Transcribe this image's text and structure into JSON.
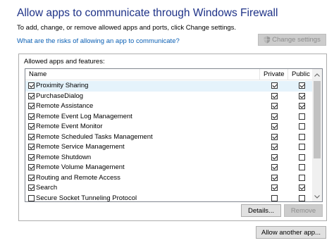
{
  "header": {
    "title": "Allow apps to communicate through Windows Firewall",
    "description": "To add, change, or remove allowed apps and ports, click Change settings.",
    "risk_link": "What are the risks of allowing an app to communicate?",
    "change_settings_label": "Change settings"
  },
  "group": {
    "label": "Allowed apps and features:"
  },
  "list": {
    "columns": {
      "name": "Name",
      "private": "Private",
      "public": "Public"
    },
    "rows": [
      {
        "name": "Proximity Sharing",
        "enabled": true,
        "private": true,
        "public": true,
        "selected": true
      },
      {
        "name": "PurchaseDialog",
        "enabled": true,
        "private": true,
        "public": true,
        "selected": false
      },
      {
        "name": "Remote Assistance",
        "enabled": true,
        "private": true,
        "public": true,
        "selected": false
      },
      {
        "name": "Remote Event Log Management",
        "enabled": true,
        "private": true,
        "public": false,
        "selected": false
      },
      {
        "name": "Remote Event Monitor",
        "enabled": true,
        "private": true,
        "public": false,
        "selected": false
      },
      {
        "name": "Remote Scheduled Tasks Management",
        "enabled": true,
        "private": true,
        "public": false,
        "selected": false
      },
      {
        "name": "Remote Service Management",
        "enabled": true,
        "private": true,
        "public": false,
        "selected": false
      },
      {
        "name": "Remote Shutdown",
        "enabled": true,
        "private": true,
        "public": false,
        "selected": false
      },
      {
        "name": "Remote Volume Management",
        "enabled": true,
        "private": true,
        "public": false,
        "selected": false
      },
      {
        "name": "Routing and Remote Access",
        "enabled": true,
        "private": true,
        "public": false,
        "selected": false
      },
      {
        "name": "Search",
        "enabled": true,
        "private": true,
        "public": true,
        "selected": false
      },
      {
        "name": "Secure Socket Tunneling Protocol",
        "enabled": false,
        "private": false,
        "public": false,
        "selected": false
      }
    ]
  },
  "buttons": {
    "details": "Details...",
    "remove": "Remove",
    "allow_another": "Allow another app..."
  },
  "icons": {
    "shield": "uac-shield-icon",
    "scroll_up": "chevron-up-icon",
    "scroll_down": "chevron-down-icon"
  },
  "colors": {
    "title": "#1e3287",
    "link": "#0a5fb4",
    "selected_row": "#e5f3fb"
  }
}
